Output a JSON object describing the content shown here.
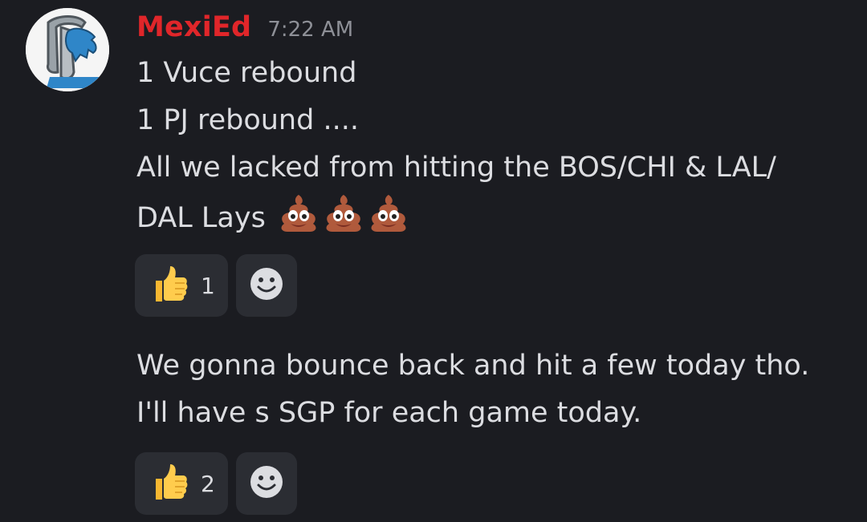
{
  "message": {
    "author": "MexiEd",
    "timestamp": "7:22 AM",
    "avatar_icon": "lions-logo-avatar",
    "lines": [
      "1 Vuce rebound",
      "1 PJ rebound ....",
      "All we lacked from hitting the BOS/CHI & LAL/",
      "DAL Lays"
    ],
    "trailing_emojis": [
      "poop-emoji",
      "poop-emoji",
      "poop-emoji"
    ],
    "reactions": [
      {
        "emoji": "thumbs-up-emoji",
        "count": "1"
      }
    ]
  },
  "message2": {
    "lines": [
      "We gonna bounce back and hit a few today tho.",
      "I'll have s SGP for each game today."
    ],
    "reactions": [
      {
        "emoji": "thumbs-up-emoji",
        "count": "2"
      }
    ]
  },
  "colors": {
    "background": "#1b1c21",
    "username": "#e0262a",
    "reaction_bg": "#2b2d33",
    "text": "#dcdde1",
    "timestamp": "#8e9097"
  }
}
